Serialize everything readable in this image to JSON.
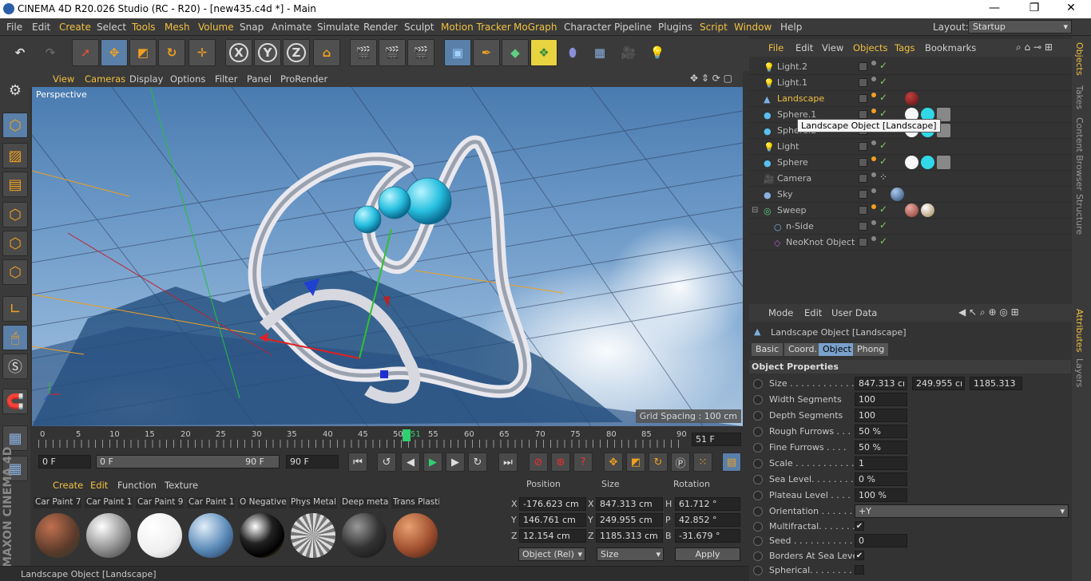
{
  "window": {
    "title": "CINEMA 4D R20.026 Studio (RC - R20) - [new435.c4d *] - Main",
    "minimize": "—",
    "restore": "❐",
    "close": "✕"
  },
  "menu": [
    "File",
    "Edit",
    "Create",
    "Select",
    "Tools",
    "Mesh",
    "Volume",
    "Snap",
    "Animate",
    "Simulate",
    "Render",
    "Sculpt",
    "Motion Tracker",
    "MoGraph",
    "Character",
    "Pipeline",
    "Plugins",
    "Script",
    "Window",
    "Help"
  ],
  "layout": {
    "label": "Layout:",
    "value": "Startup"
  },
  "toolbar": {
    "x": "X",
    "y": "Y",
    "z": "Z"
  },
  "viewport": {
    "menu": [
      "View",
      "Cameras",
      "Display",
      "Options",
      "Filter",
      "Panel",
      "ProRender"
    ],
    "label": "Perspective",
    "grid_spacing": "Grid Spacing : 100 cm"
  },
  "timeline": {
    "ticks": [
      "0",
      "5",
      "10",
      "15",
      "20",
      "25",
      "30",
      "35",
      "40",
      "45",
      "50",
      "51",
      "55",
      "60",
      "65",
      "70",
      "75",
      "80",
      "85",
      "90"
    ],
    "current_frame": "51 F",
    "start": "0 F",
    "range_start": "0 F",
    "range_end": "90 F",
    "end": "90 F"
  },
  "materials": {
    "menu": [
      "Create",
      "Edit",
      "Function",
      "Texture"
    ],
    "items": [
      {
        "name": "Car Paint 7",
        "color": "#7a4a30"
      },
      {
        "name": "Car Paint 1",
        "color": "#bbbbbb"
      },
      {
        "name": "Car Paint 9",
        "color": "#f8f8f8"
      },
      {
        "name": "Car Paint 1",
        "color": "#5a8ab8"
      },
      {
        "name": "O Negative",
        "color": "#111111"
      },
      {
        "name": "Phys Metal",
        "color": "#cccccc"
      },
      {
        "name": "Deep meta",
        "color": "#333333"
      },
      {
        "name": "Trans Plasti",
        "color": "#a05030"
      }
    ]
  },
  "coords": {
    "headers": [
      "Position",
      "Size",
      "Rotation"
    ],
    "rows": [
      {
        "a": "X",
        "pos": "-176.623 cm",
        "b": "X",
        "size": "847.313 cm",
        "c": "H",
        "rot": "61.712 °"
      },
      {
        "a": "Y",
        "pos": "146.761 cm",
        "b": "Y",
        "size": "249.955 cm",
        "c": "P",
        "rot": "42.852 °"
      },
      {
        "a": "Z",
        "pos": "12.154 cm",
        "b": "Z",
        "size": "1185.313 cm",
        "c": "B",
        "rot": "-31.679 °"
      }
    ],
    "mode": "Object (Rel)",
    "size_mode": "Size",
    "apply": "Apply"
  },
  "status": "Landscape Object [Landscape]",
  "objects": {
    "menu": [
      "File",
      "Edit",
      "View",
      "Objects",
      "Tags",
      "Bookmarks"
    ],
    "items": [
      {
        "name": "Light.2",
        "icon": "💡"
      },
      {
        "name": "Light.1",
        "icon": "💡"
      },
      {
        "name": "Landscape",
        "icon": "▲"
      },
      {
        "name": "Sphere.1",
        "icon": "●"
      },
      {
        "name": "Sphere.2",
        "icon": "●"
      },
      {
        "name": "Light",
        "icon": "💡"
      },
      {
        "name": "Sphere",
        "icon": "●"
      },
      {
        "name": "Camera",
        "icon": "■"
      },
      {
        "name": "Sky",
        "icon": "●"
      },
      {
        "name": "Sweep",
        "icon": "◎"
      },
      {
        "name": "n-Side",
        "icon": "○"
      },
      {
        "name": "NeoKnot Object",
        "icon": "◇"
      }
    ],
    "tooltip": "Landscape Object [Landscape]"
  },
  "attributes": {
    "menu": [
      "Mode",
      "Edit",
      "User Data"
    ],
    "title": "Landscape Object [Landscape]",
    "tabs": [
      "Basic",
      "Coord.",
      "Object",
      "Phong"
    ],
    "section": "Object Properties",
    "rows": [
      {
        "label": "Size . . . . . . . . . . . . .",
        "v1": "847.313 cı",
        "v2": "249.955 cı",
        "v3": "1185.313"
      },
      {
        "label": "Width Segments",
        "v1": "100"
      },
      {
        "label": "Depth Segments",
        "v1": "100"
      },
      {
        "label": "Rough Furrows . . .",
        "v1": "50 %"
      },
      {
        "label": "Fine Furrows . . . .",
        "v1": "50 %"
      },
      {
        "label": "Scale . . . . . . . . . . . .",
        "v1": "1"
      },
      {
        "label": "Sea Level. . . . . . . . .",
        "v1": "0 %"
      },
      {
        "label": "Plateau Level . . . .",
        "v1": "100 %"
      },
      {
        "label": "Orientation . . . . . . .",
        "v1": "+Y"
      },
      {
        "label": "Multifractal. . . . . . .",
        "v1": "✔"
      },
      {
        "label": "Seed . . . . . . . . . . . .",
        "v1": "0"
      },
      {
        "label": "Borders At Sea Level",
        "v1": "✔"
      },
      {
        "label": "Spherical. . . . . . . . .",
        "v1": ""
      }
    ]
  },
  "sidetabs": {
    "top": [
      "Objects",
      "Takes",
      "Content Browser",
      "Structure"
    ],
    "bottom": [
      "Attributes",
      "Layers"
    ]
  },
  "branding": "MAXON CINEMA 4D"
}
